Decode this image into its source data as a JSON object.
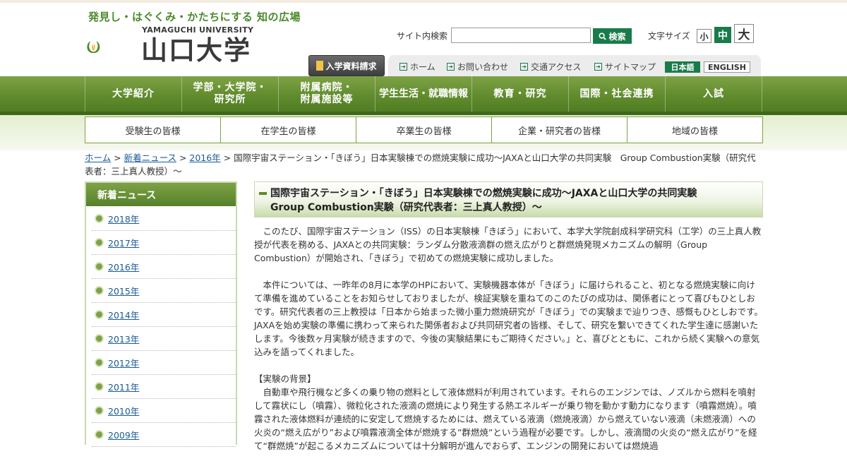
{
  "header": {
    "tagline": "発見し・はぐくみ・かたちにする 知の広場",
    "logo_en": "YAMAGUCHI UNIVERSITY",
    "logo_jp": "山口大学",
    "search_label": "サイト内検索",
    "search_value": "",
    "search_button": "検索",
    "fontsize_label": "文字サイズ",
    "fontsize_small": "小",
    "fontsize_medium": "中",
    "fontsize_large": "大",
    "request_button": "入学資料請求",
    "util_links": [
      "ホーム",
      "お問い合わせ",
      "交通アクセス",
      "サイトマップ"
    ],
    "lang_ja": "日本語",
    "lang_en": "ENGLISH"
  },
  "global_nav": [
    "大学紹介",
    "学部・大学院・\n研究所",
    "附属病院・\n附属施設等",
    "学生生活・就職情報",
    "教育・研究",
    "国際・社会連携",
    "入試"
  ],
  "sub_nav": [
    "受験生の皆様",
    "在学生の皆様",
    "卒業生の皆様",
    "企業・研究者の皆様",
    "地域の皆様"
  ],
  "breadcrumb": {
    "links": [
      "ホーム",
      "新着ニュース",
      "2016年"
    ],
    "separator": " > ",
    "current": "国際宇宙ステーション・「きぼう」日本実験棟での燃焼実験に成功～JAXAと山口大学の共同実験　Group Combustion実験（研究代表者：三上真人教授）～"
  },
  "sidebar": {
    "title": "新着ニュース",
    "items": [
      "2018年",
      "2017年",
      "2016年",
      "2015年",
      "2014年",
      "2013年",
      "2012年",
      "2011年",
      "2010年",
      "2009年"
    ]
  },
  "article": {
    "title_line1": "国際宇宙ステーション・「きぼう」日本実験棟での燃焼実験に成功～JAXAと山口大学の共同実験",
    "title_line2": "Group Combustion実験（研究代表者：三上真人教授）～",
    "para1": "　このたび、国際宇宙ステーション（ISS）の日本実験棟「きぼう」において、本学大学院創成科学研究科（工学）の三上真人教授が代表を務める、JAXAとの共同実験：ランダム分散液滴群の燃え広がりと群燃焼発現メカニズムの解明（Group Combustion）が開始され、「きぼう」で初めての燃焼実験に成功しました。",
    "para2": "　本件については、一昨年の8月に本学のHPにおいて、実験機器本体が「きぼう」に届けられること、初となる燃焼実験に向けて準備を進めていることをお知らせしておりましたが、検証実験を重ねてのこのたびの成功は、関係者にとって喜びもひとしおです。研究代表者の三上教授は「日本から始まった微小重力燃焼研究が「きぼう」での実験まで辿りつき、感慨もひとしおです。JAXAを始め実験の準備に携わって来られた関係者および共同研究者の皆様、そして、研究を繋いできてくれた学生達に感謝いたします。今後数ヶ月実験が続きますので、今後の実験結果にもご期待ください。」と、喜びとともに、これから続く実験への意気込みを語ってくれました。",
    "section_heading": "【実験の背景】",
    "para3": "　自動車や飛行機など多くの乗り物の燃料として液体燃料が利用されています。それらのエンジンでは、ノズルから燃料を噴射して霧状にし（噴霧）、微粒化された液滴の燃焼により発生する熱エネルギーが乗り物を動かす動力になります（噴霧燃焼）。噴霧された液体燃料が連続的に安定して燃焼するためには、燃えている液滴（燃焼液滴）から燃えていない液滴（未燃液滴）への火炎の“燃え広がり”および噴霧液滴全体が燃焼する”群燃焼”という過程が必要です。しかし、液滴間の火炎の“燃え広がり”を経て“群燃焼”が起こるメカニズムについては十分解明が進んでおらず、エンジンの開発においては燃焼過"
  },
  "colors": {
    "brand_green": "#1a7b4a",
    "nav_green": "#5f8a2c",
    "link_blue": "#1a5a9a"
  }
}
